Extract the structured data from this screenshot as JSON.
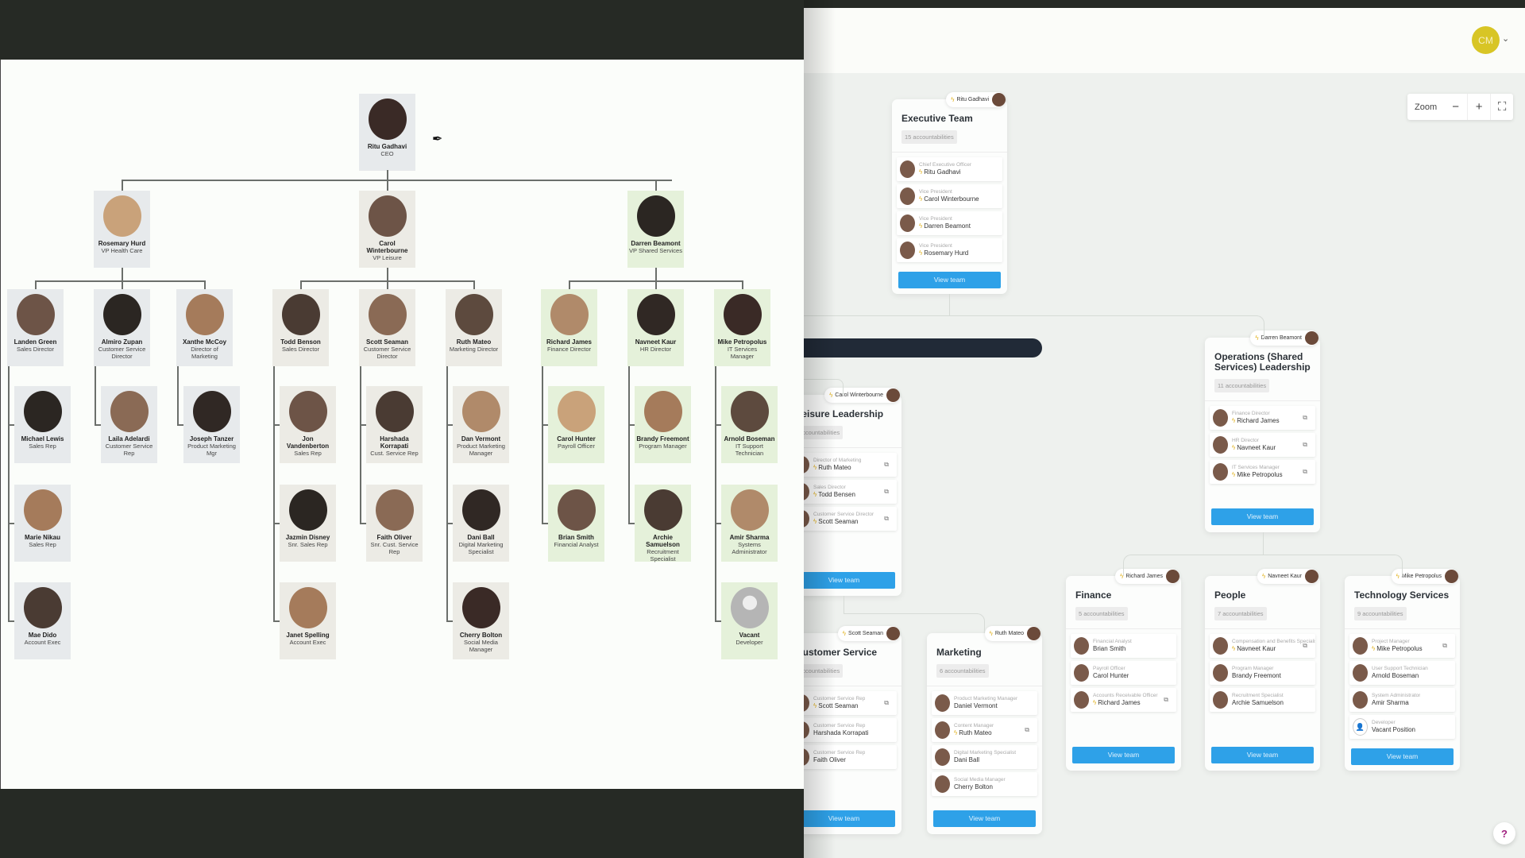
{
  "org_chart": {
    "ceo": {
      "name": "Ritu Gadhavi",
      "title": "CEO"
    },
    "vps": [
      {
        "name": "Rosemary Hurd",
        "title": "VP Health Care"
      },
      {
        "name": "Carol Winterbourne",
        "title": "VP Leisure"
      },
      {
        "name": "Darren Beamont",
        "title": "VP Shared Services"
      }
    ],
    "directors": [
      {
        "name": "Landen Green",
        "title": "Sales Director",
        "reports": [
          {
            "name": "Michael Lewis",
            "title": "Sales Rep"
          },
          {
            "name": "Marie Nikau",
            "title": "Sales Rep"
          },
          {
            "name": "Mae Dido",
            "title": "Account Exec"
          }
        ]
      },
      {
        "name": "Almiro Zupan",
        "title": "Customer Service Director",
        "reports": [
          {
            "name": "Laila Adelardi",
            "title": "Customer Service Rep"
          }
        ]
      },
      {
        "name": "Xanthe McCoy",
        "title": "Director of Marketing",
        "reports": [
          {
            "name": "Joseph Tanzer",
            "title": "Product Marketing Mgr"
          }
        ]
      },
      {
        "name": "Todd Benson",
        "title": "Sales Director",
        "reports": [
          {
            "name": "Jon Vandenberton",
            "title": "Sales Rep"
          },
          {
            "name": "Jazmin Disney",
            "title": "Snr. Sales Rep"
          },
          {
            "name": "Janet Spelling",
            "title": "Account Exec"
          }
        ]
      },
      {
        "name": "Scott Seaman",
        "title": "Customer Service Director",
        "reports": [
          {
            "name": "Harshada Korrapati",
            "title": "Cust. Service Rep"
          },
          {
            "name": "Faith Oliver",
            "title": "Snr. Cust. Service Rep"
          }
        ]
      },
      {
        "name": "Ruth Mateo",
        "title": "Marketing Director",
        "reports": [
          {
            "name": "Dan Vermont",
            "title": "Product Marketing Manager"
          },
          {
            "name": "Dani Ball",
            "title": "Digital Marketing Specialist"
          },
          {
            "name": "Cherry Bolton",
            "title": "Social Media Manager"
          }
        ]
      },
      {
        "name": "Richard James",
        "title": "Finance Director",
        "reports": [
          {
            "name": "Carol Hunter",
            "title": "Payroll Officer"
          },
          {
            "name": "Brian Smith",
            "title": "Financial Analyst"
          }
        ]
      },
      {
        "name": "Navneet Kaur",
        "title": "HR Director",
        "reports": [
          {
            "name": "Brandy Freemont",
            "title": "Program Manager"
          },
          {
            "name": "Archie Samuelson",
            "title": "Recruitment Specialist"
          }
        ]
      },
      {
        "name": "Mike Petropolus",
        "title": "IT Services Manager",
        "reports": [
          {
            "name": "Arnold Boseman",
            "title": "IT Support Technician"
          },
          {
            "name": "Amir Sharma",
            "title": "Systems Administrator"
          },
          {
            "name": "Vacant",
            "title": "Developer"
          }
        ]
      }
    ]
  },
  "app": {
    "user_initials": "CM",
    "zoom": {
      "label": "Zoom",
      "minus": "−",
      "plus": "+",
      "fullscreen": "⛶"
    },
    "help": "?",
    "teams": [
      {
        "id": "executive",
        "title": "Executive Team",
        "count": "15 accountabilities",
        "owner": "Ritu Gadhavi",
        "view_label": "View team",
        "accountabilities": [
          {
            "role": "Chief Executive Officer",
            "name": "Ritu Gadhavi",
            "lead": true,
            "copy": false
          },
          {
            "role": "Vice President",
            "name": "Carol Winterbourne",
            "lead": true,
            "copy": false
          },
          {
            "role": "Vice President",
            "name": "Darren Beamont",
            "lead": true,
            "copy": false
          },
          {
            "role": "Vice President",
            "name": "Rosemary Hurd",
            "lead": true,
            "copy": false
          }
        ]
      },
      {
        "id": "operations",
        "title": "Operations (Shared Services) Leadership",
        "count": "11 accountabilities",
        "owner": "Darren Beamont",
        "view_label": "View team",
        "accountabilities": [
          {
            "role": "Finance Director",
            "name": "Richard James",
            "lead": true,
            "copy": true
          },
          {
            "role": "HR Director",
            "name": "Navneet Kaur",
            "lead": true,
            "copy": true
          },
          {
            "role": "IT Services Manager",
            "name": "Mike Petropolus",
            "lead": true,
            "copy": true
          }
        ]
      },
      {
        "id": "leisure",
        "title": "Leisure Leadership",
        "count": "accountabilities",
        "owner": "Carol Winterbourne",
        "view_label": "View team",
        "accountabilities": [
          {
            "role": "Director of Marketing",
            "name": "Ruth Mateo",
            "lead": true,
            "copy": true
          },
          {
            "role": "Sales Director",
            "name": "Todd Bensen",
            "lead": true,
            "copy": true
          },
          {
            "role": "Customer Service Director",
            "name": "Scott Seaman",
            "lead": true,
            "copy": true
          }
        ]
      },
      {
        "id": "customer-service",
        "title": "Customer Service",
        "count": "accountabilities",
        "owner": "Scott Seaman",
        "view_label": "View team",
        "accountabilities": [
          {
            "role": "Customer Service Rep",
            "name": "Scott Seaman",
            "lead": true,
            "copy": true
          },
          {
            "role": "Customer Service Rep",
            "name": "Harshada Korrapati",
            "lead": false,
            "copy": false
          },
          {
            "role": "Customer Service Rep",
            "name": "Faith Oliver",
            "lead": false,
            "copy": false
          }
        ]
      },
      {
        "id": "marketing",
        "title": "Marketing",
        "count": "6 accountabilities",
        "owner": "Ruth Mateo",
        "view_label": "View team",
        "accountabilities": [
          {
            "role": "Product Marketing Manager",
            "name": "Daniel Vermont",
            "lead": false,
            "copy": false
          },
          {
            "role": "Content Manager",
            "name": "Ruth Mateo",
            "lead": true,
            "copy": true
          },
          {
            "role": "Digital Marketing Specialist",
            "name": "Dani Ball",
            "lead": false,
            "copy": false
          },
          {
            "role": "Social Media Manager",
            "name": "Cherry Bolton",
            "lead": false,
            "copy": false
          }
        ]
      },
      {
        "id": "finance",
        "title": "Finance",
        "count": "5 accountabilities",
        "owner": "Richard James",
        "view_label": "View team",
        "accountabilities": [
          {
            "role": "Financial Analyst",
            "name": "Brian Smith",
            "lead": false,
            "copy": false
          },
          {
            "role": "Payroll Officer",
            "name": "Carol Hunter",
            "lead": false,
            "copy": false
          },
          {
            "role": "Accounts Receivable Officer",
            "name": "Richard James",
            "lead": true,
            "copy": true
          }
        ]
      },
      {
        "id": "people",
        "title": "People",
        "count": "7 accountabilities",
        "owner": "Navneet Kaur",
        "view_label": "View team",
        "accountabilities": [
          {
            "role": "Compensation and Benefits Specialist",
            "name": "Navneet Kaur",
            "lead": true,
            "copy": true
          },
          {
            "role": "Program Manager",
            "name": "Brandy Freemont",
            "lead": false,
            "copy": false
          },
          {
            "role": "Recruitment Specialist",
            "name": "Archie Samuelson",
            "lead": false,
            "copy": false
          }
        ]
      },
      {
        "id": "technology",
        "title": "Technology Services",
        "count": "9 accountabilities",
        "owner": "Mike Petropolus",
        "view_label": "View team",
        "accountabilities": [
          {
            "role": "Project Manager",
            "name": "Mike Petropolus",
            "lead": true,
            "copy": true
          },
          {
            "role": "User Support Technician",
            "name": "Arnold Boseman",
            "lead": false,
            "copy": false
          },
          {
            "role": "System Administrator",
            "name": "Amir Sharma",
            "lead": false,
            "copy": false
          },
          {
            "role": "Developer",
            "name": "Vacant Position",
            "lead": false,
            "copy": false,
            "vacant": true
          }
        ]
      }
    ]
  },
  "colors": {
    "accent_blue": "#2ea1e8",
    "lead_bolt": "#e3b423",
    "user_avatar": "#d8c525",
    "healthcare_node": "#e7eaec",
    "leisure_node": "#ecebe5",
    "shared_services_node": "#e5f1da"
  }
}
